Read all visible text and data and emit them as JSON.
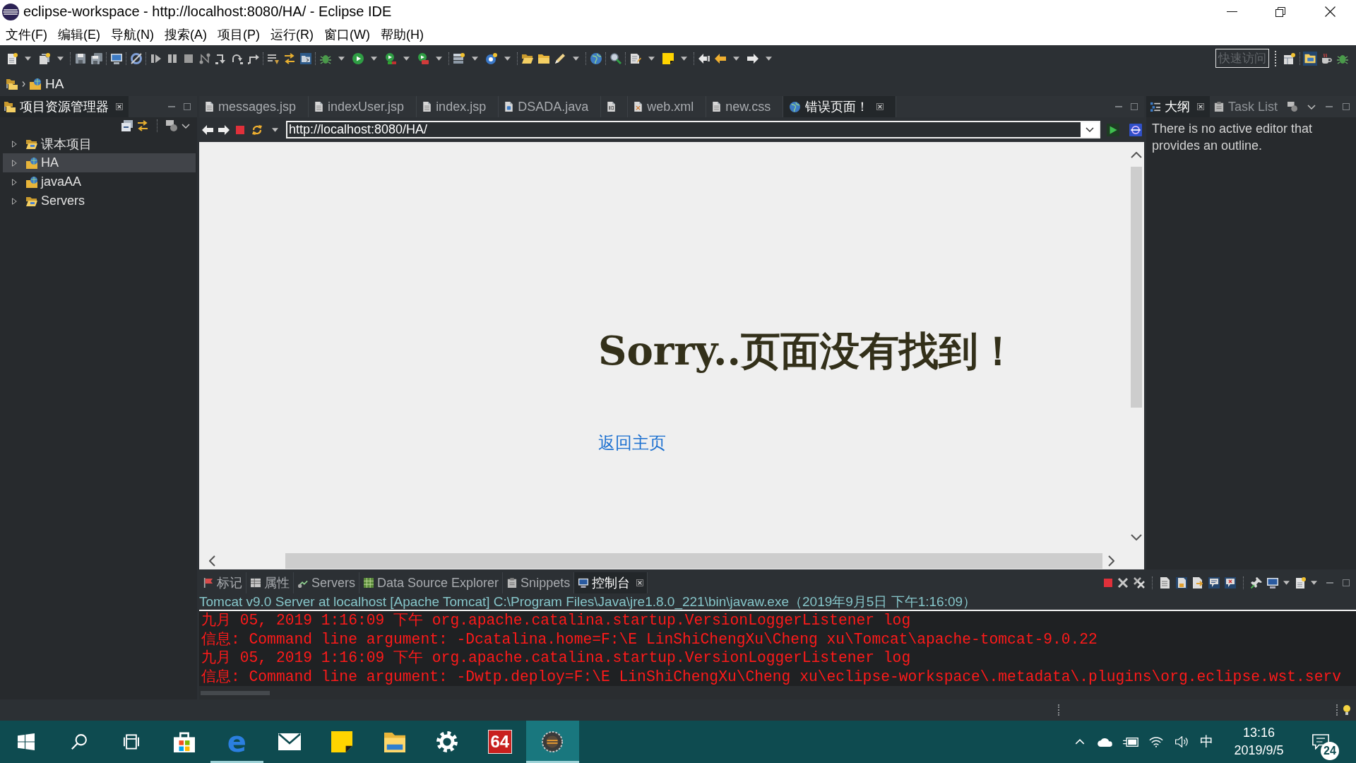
{
  "window": {
    "title": "eclipse-workspace - http://localhost:8080/HA/ - Eclipse IDE"
  },
  "menu": [
    "文件(F)",
    "编辑(E)",
    "导航(N)",
    "搜索(A)",
    "项目(P)",
    "运行(R)",
    "窗口(W)",
    "帮助(H)"
  ],
  "toolbar": {
    "quick_access": {
      "placeholder": "快速访问"
    }
  },
  "breadcrumb": {
    "items": [
      "HA"
    ]
  },
  "project_explorer": {
    "title": "项目资源管理器",
    "items": [
      {
        "label": "课本项目",
        "kind": "folder",
        "expanded": false,
        "selected": false
      },
      {
        "label": "HA",
        "kind": "project",
        "expanded": false,
        "selected": true
      },
      {
        "label": "javaAA",
        "kind": "project",
        "expanded": false,
        "selected": false
      },
      {
        "label": "Servers",
        "kind": "folder",
        "expanded": false,
        "selected": false
      }
    ]
  },
  "editor": {
    "tabs": [
      {
        "label": "messages.jsp",
        "kind": "file",
        "selected": false
      },
      {
        "label": "indexUser.jsp",
        "kind": "file",
        "selected": false
      },
      {
        "label": "index.jsp",
        "kind": "file",
        "selected": false
      },
      {
        "label": "DSADA.java",
        "kind": "java",
        "selected": false
      },
      {
        "kind": "class",
        "selected": false
      },
      {
        "label": "web.xml",
        "kind": "xml",
        "selected": false
      },
      {
        "label": "new.css",
        "kind": "file",
        "selected": false
      },
      {
        "label": "错误页面！",
        "kind": "web",
        "selected": true
      }
    ],
    "browser": {
      "url": "http://localhost:8080/HA/",
      "heading": "Sorry..页面没有找到！",
      "link": "返回主页"
    }
  },
  "outline": {
    "tabs": [
      {
        "label": "大纲",
        "kind": "outline",
        "selected": true
      },
      {
        "label": "Task List",
        "kind": "tasks",
        "selected": false
      }
    ],
    "message": "There is no active editor that provides an outline."
  },
  "bottom_panel": {
    "tabs": [
      {
        "label": "标记",
        "kind": "markers",
        "selected": false
      },
      {
        "label": "属性",
        "kind": "properties",
        "selected": false
      },
      {
        "label": "Servers",
        "kind": "servers",
        "selected": false
      },
      {
        "label": "Data Source Explorer",
        "kind": "datasource",
        "selected": false
      },
      {
        "label": "Snippets",
        "kind": "snippets",
        "selected": false
      },
      {
        "label": "控制台",
        "kind": "console",
        "selected": true
      }
    ],
    "console": {
      "description": "Tomcat v9.0 Server at localhost [Apache Tomcat] C:\\Program Files\\Java\\jre1.8.0_221\\bin\\javaw.exe（2019年9月5日 下午1:16:09）",
      "lines": [
        "九月 05, 2019 1:16:09 下午 org.apache.catalina.startup.VersionLoggerListener log",
        "信息: Command line argument: -Dcatalina.home=F:\\E LinShiChengXu\\Cheng xu\\Tomcat\\apache-tomcat-9.0.22",
        "九月 05, 2019 1:16:09 下午 org.apache.catalina.startup.VersionLoggerListener log",
        "信息: Command line argument: -Dwtp.deploy=F:\\E LinShiChengXu\\Cheng xu\\eclipse-workspace\\.metadata\\.plugins\\org.eclipse.wst.serv"
      ]
    }
  },
  "taskbar": {
    "buttons": [
      {
        "kind": "start"
      },
      {
        "kind": "search"
      },
      {
        "kind": "taskview"
      }
    ],
    "apps": [
      {
        "kind": "bag",
        "running": false,
        "selected": false
      },
      {
        "kind": "browser",
        "label": "e",
        "running": true,
        "selected": false
      },
      {
        "kind": "mail",
        "running": false,
        "selected": false
      },
      {
        "kind": "note",
        "running": false,
        "selected": false
      },
      {
        "kind": "folder",
        "running": false,
        "selected": false
      },
      {
        "kind": "gear",
        "running": false,
        "selected": false
      },
      {
        "kind": "tile",
        "label": "64",
        "running": false,
        "selected": false
      },
      {
        "kind": "app",
        "running": true,
        "selected": true
      }
    ],
    "tray": {
      "input_method": "中",
      "time": "13:16",
      "date": "2019/9/5",
      "notifications": "24"
    }
  }
}
